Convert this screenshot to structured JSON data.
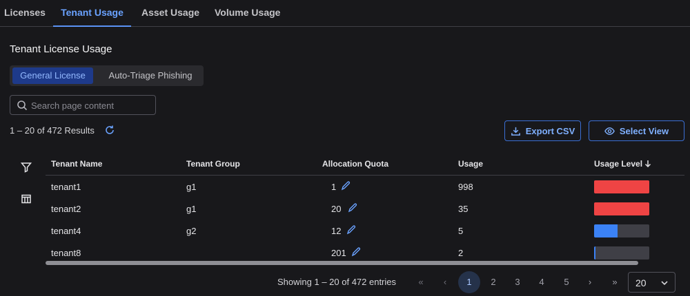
{
  "tabs": [
    {
      "label": "Licenses",
      "active": false
    },
    {
      "label": "Tenant Usage",
      "active": true
    },
    {
      "label": "Asset Usage",
      "active": false
    },
    {
      "label": "Volume Usage",
      "active": false
    }
  ],
  "section_title": "Tenant License Usage",
  "segments": [
    {
      "label": "General License",
      "active": true
    },
    {
      "label": "Auto-Triage Phishing",
      "active": false
    }
  ],
  "search": {
    "placeholder": "Search page content",
    "value": ""
  },
  "results_text": "1 – 20 of 472 Results",
  "actions": {
    "export_label": "Export CSV",
    "select_view_label": "Select View"
  },
  "columns": [
    "Tenant Name",
    "Tenant Group",
    "Allocation Quota",
    "Usage",
    "Usage Level"
  ],
  "sort_column": "Usage Level",
  "sort_direction": "descending",
  "rows": [
    {
      "tenant_name": "tenant1",
      "tenant_group": "g1",
      "allocation_quota": "1",
      "usage": "998",
      "usage_level": 1.0,
      "level_color": "#ef4444"
    },
    {
      "tenant_name": "tenant2",
      "tenant_group": "g1",
      "allocation_quota": "20",
      "usage": "35",
      "usage_level": 1.0,
      "level_color": "#ef4444"
    },
    {
      "tenant_name": "tenant4",
      "tenant_group": "g2",
      "allocation_quota": "12",
      "usage": "5",
      "usage_level": 0.42,
      "level_color": "#3b82f6"
    },
    {
      "tenant_name": "tenant8",
      "tenant_group": "",
      "allocation_quota": "201",
      "usage": "2",
      "usage_level": 0.01,
      "level_color": "#3b82f6"
    }
  ],
  "pagination": {
    "showing_text": "Showing 1 – 20 of 472 entries",
    "pages": [
      "1",
      "2",
      "3",
      "4",
      "5"
    ],
    "current_page": "1",
    "first_symbol": "«",
    "prev_symbol": "‹",
    "next_symbol": "›",
    "last_symbol": "»",
    "page_size": "20"
  },
  "icons": {
    "search": "search-icon",
    "refresh": "refresh-icon",
    "export": "download-icon",
    "select_view": "eye-icon",
    "filter": "filter-icon",
    "columns": "columns-icon",
    "edit": "pencil-icon",
    "sort": "arrow-down-icon",
    "page_size_dropdown": "chevron-down-icon"
  },
  "colors": {
    "accent": "#5b93f6",
    "danger": "#ef4444",
    "info": "#3b82f6",
    "background": "#18181b"
  }
}
